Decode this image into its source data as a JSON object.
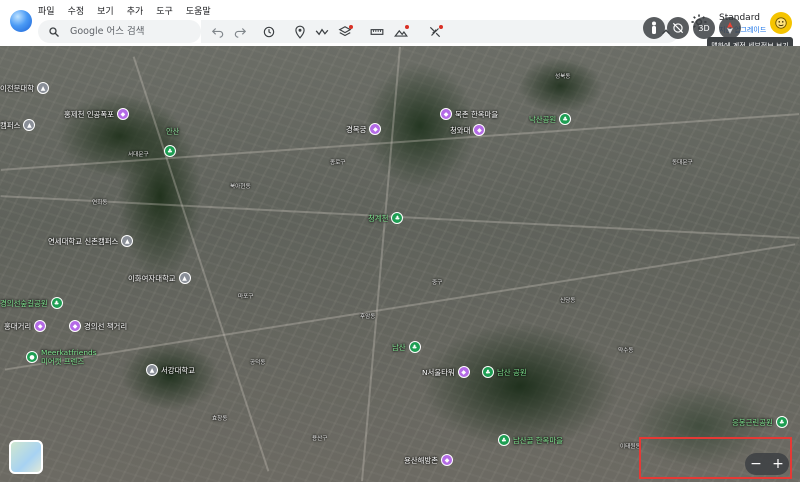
{
  "menu": [
    "파일",
    "수정",
    "보기",
    "추가",
    "도구",
    "도움말"
  ],
  "search": {
    "placeholder": "Google 어스 검색"
  },
  "account": {
    "plan": "Standard",
    "upgrade": "지금 업그레이드",
    "tooltip": "맵화에 계정 세부정보 보기"
  },
  "poi": {
    "hongjecheon": "홍제천 인공폭포",
    "sinchon": "연세대학교 신촌캠퍼스",
    "ewha": "이화여자대학교",
    "gyeongui": "경의선 책거리",
    "meerkat": "Meerkatfriends\n미어캣 프렌즈",
    "sogang": "서강대학교",
    "gyeongbok": "경복궁",
    "bukchon": "북촌 한옥마을",
    "cheongwadae": "청와대",
    "cheonggye": "청계천",
    "namsan_tower": "N서울타워",
    "namsan_park": "남산 공원",
    "namsan_hanok": "남산골 한옥마을",
    "namsan": "남산",
    "yongsan": "용산해방촌",
    "naksan": "낙산공원",
    "ansan": "안산",
    "gyeongui_park": "경의선숲길공원",
    "hongdae": "홍대거리",
    "left_univ": "이전문대학",
    "left_camp": "캠퍼스",
    "right_park": "응봉근린공원"
  },
  "labels": {
    "l1": "서대문구",
    "l2": "연희동",
    "l3": "북아현동",
    "l4": "종로구",
    "l5": "중구",
    "l6": "용산구",
    "l7": "마포구",
    "l8": "성북동",
    "l9": "동대문구",
    "l10": "신당동",
    "l11": "후암동",
    "l12": "이태원동",
    "l13": "공덕동",
    "l14": "효창동",
    "l15": "약수동"
  },
  "controls": {
    "threeD": "3D",
    "zoom_in": "+",
    "zoom_out": "−"
  }
}
